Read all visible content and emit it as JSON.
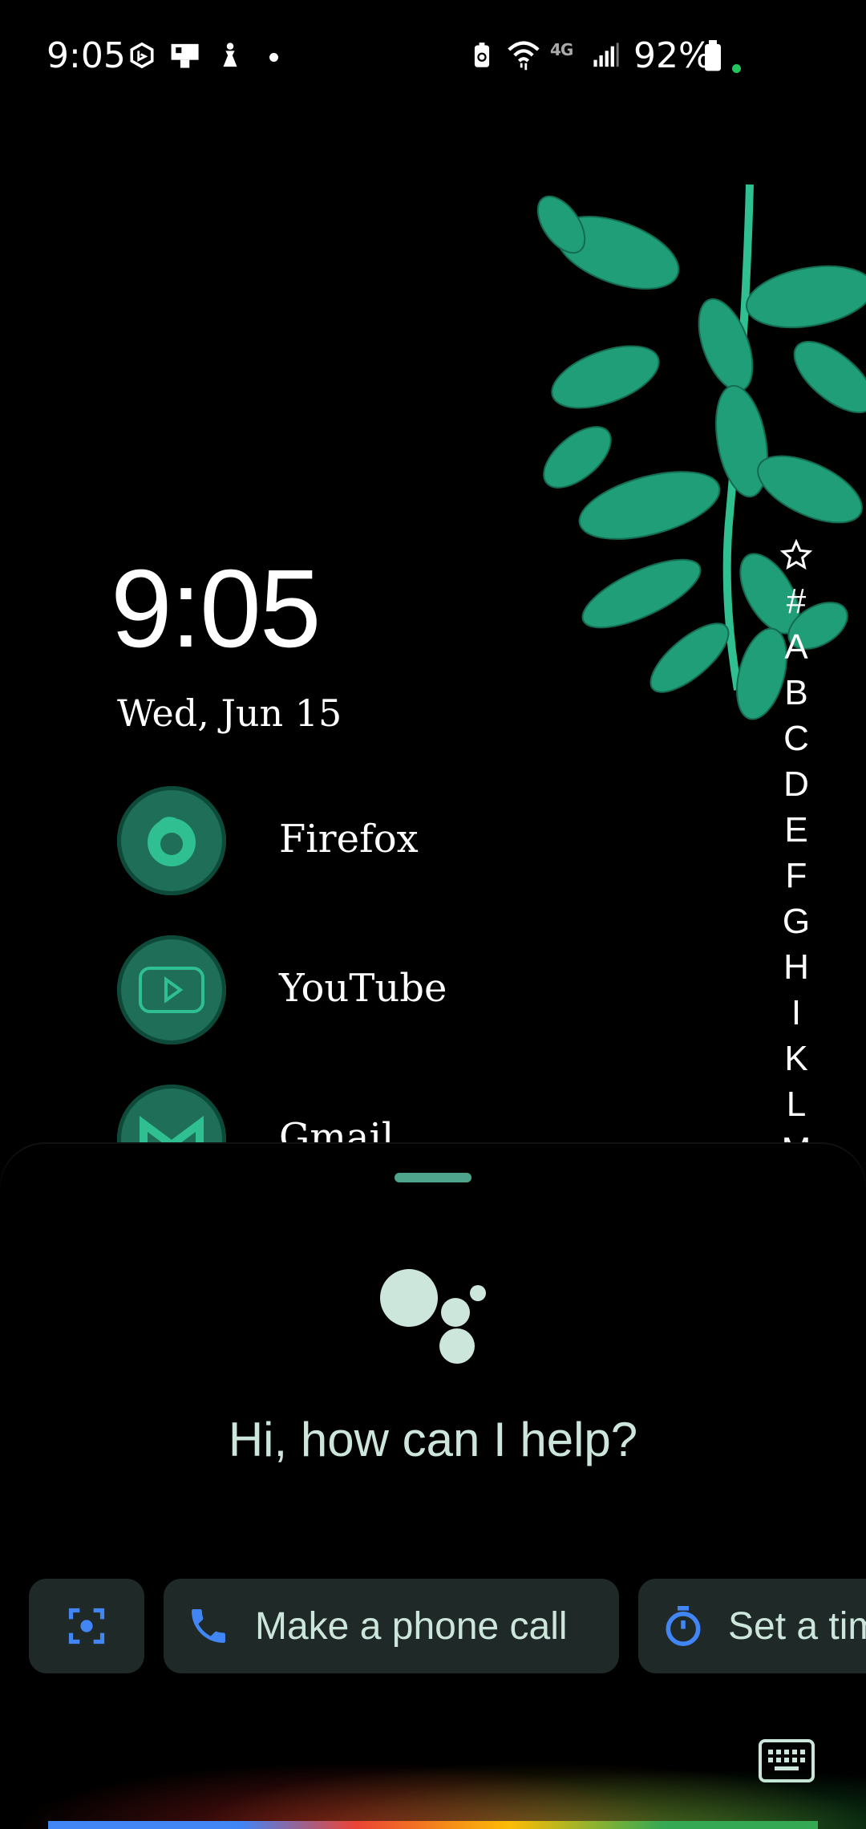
{
  "status_bar": {
    "time": "9:05",
    "battery_percent": "92%",
    "network_label": "4G",
    "left_icons": [
      "bing-icon",
      "tablet-usb-icon",
      "accessibility-icon",
      "notification-dot-icon"
    ],
    "right_icons": [
      "battery-saver-icon",
      "wifi-icon",
      "signal-icon",
      "battery-icon"
    ]
  },
  "widget": {
    "clock": "9:05",
    "date": "Wed, Jun 15"
  },
  "apps": [
    {
      "label": "Firefox"
    },
    {
      "label": "YouTube"
    },
    {
      "label": "Gmail"
    }
  ],
  "alphabet_index": [
    "#",
    "A",
    "B",
    "C",
    "D",
    "E",
    "F",
    "G",
    "H",
    "I",
    "K",
    "L",
    "M"
  ],
  "assistant": {
    "prompt": "Hi, how can I help?",
    "chips": [
      {
        "label": "",
        "icon": "lens-icon"
      },
      {
        "label": "Make a phone call",
        "icon": "phone-icon"
      },
      {
        "label": "Set a timer",
        "icon": "timer-icon"
      }
    ]
  },
  "colors": {
    "accent": "#2fbf91",
    "leaf": "#1f9e77",
    "chip_bg": "#1f2a28",
    "assistant_text": "#cde6dc",
    "google_blue": "#4285f4"
  }
}
